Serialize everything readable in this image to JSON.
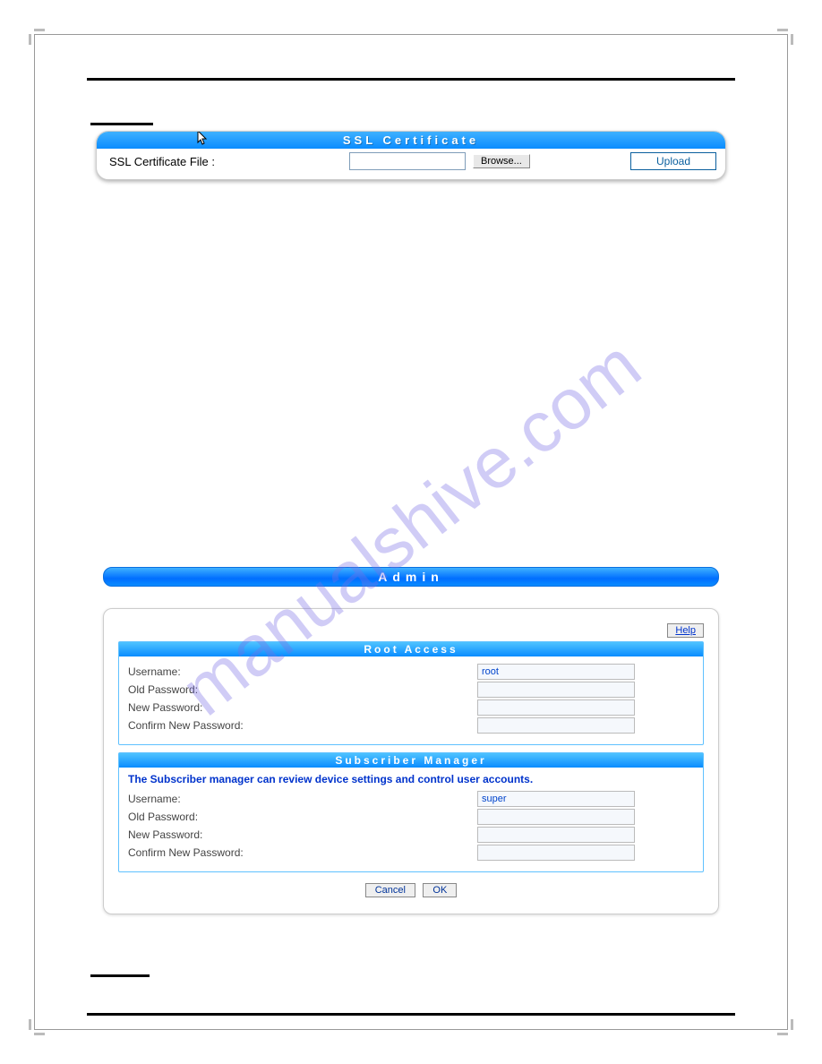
{
  "watermark": "manualshive.com",
  "ssl": {
    "title": "SSL Certificate",
    "label": "SSL Certificate File :",
    "browse": "Browse...",
    "upload": "Upload"
  },
  "admin": {
    "title": "Admin",
    "help": "Help",
    "root": {
      "title": "Root Access",
      "username_label": "Username:",
      "username_value": "root",
      "old_pw_label": "Old Password:",
      "new_pw_label": "New Password:",
      "confirm_pw_label": "Confirm New Password:"
    },
    "sub": {
      "title": "Subscriber Manager",
      "info": "The Subscriber manager can review device settings and control user accounts.",
      "username_label": "Username:",
      "username_value": "super",
      "old_pw_label": "Old Password:",
      "new_pw_label": "New Password:",
      "confirm_pw_label": "Confirm New Password:"
    },
    "cancel": "Cancel",
    "ok": "OK"
  }
}
